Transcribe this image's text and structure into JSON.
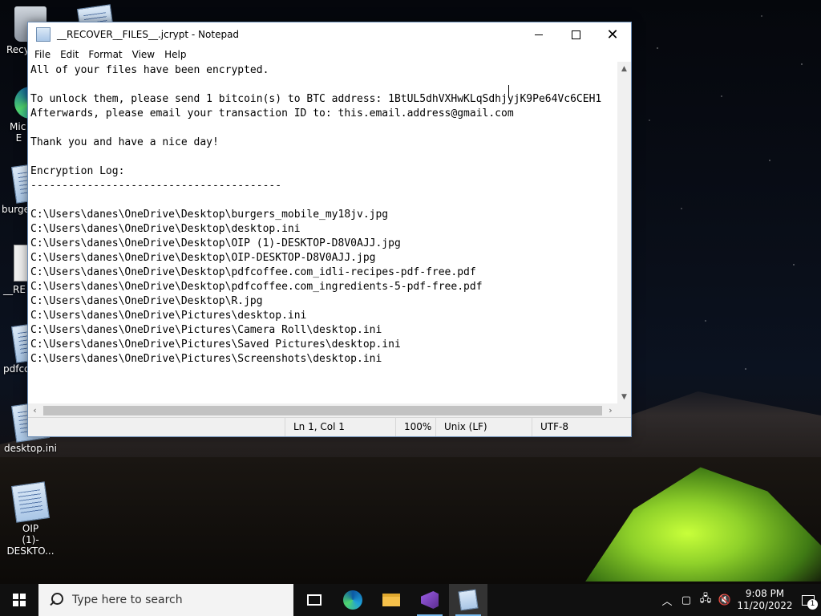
{
  "window": {
    "title": "__RECOVER__FILES__.jcrypt - Notepad",
    "minimize": "",
    "maximize": "",
    "close": "✕"
  },
  "menu": [
    "File",
    "Edit",
    "Format",
    "View",
    "Help"
  ],
  "editor": {
    "lines": [
      "All of your files have been encrypted.",
      "",
      "To unlock them, please send 1 bitcoin(s) to BTC address: 1BtUL5dhVXHwKLqSdhjyjK9Pe64Vc6CEH1",
      "Afterwards, please email your transaction ID to: this.email.address@gmail.com",
      "",
      "Thank you and have a nice day!",
      "",
      "Encryption Log:",
      "----------------------------------------",
      "",
      "C:\\Users\\danes\\OneDrive\\Desktop\\burgers_mobile_my18jv.jpg",
      "C:\\Users\\danes\\OneDrive\\Desktop\\desktop.ini",
      "C:\\Users\\danes\\OneDrive\\Desktop\\OIP (1)-DESKTOP-D8V0AJJ.jpg",
      "C:\\Users\\danes\\OneDrive\\Desktop\\OIP-DESKTOP-D8V0AJJ.jpg",
      "C:\\Users\\danes\\OneDrive\\Desktop\\pdfcoffee.com_idli-recipes-pdf-free.pdf",
      "C:\\Users\\danes\\OneDrive\\Desktop\\pdfcoffee.com_ingredients-5-pdf-free.pdf",
      "C:\\Users\\danes\\OneDrive\\Desktop\\R.jpg",
      "C:\\Users\\danes\\OneDrive\\Pictures\\desktop.ini",
      "C:\\Users\\danes\\OneDrive\\Pictures\\Camera Roll\\desktop.ini",
      "C:\\Users\\danes\\OneDrive\\Pictures\\Saved Pictures\\desktop.ini",
      "C:\\Users\\danes\\OneDrive\\Pictures\\Screenshots\\desktop.ini"
    ]
  },
  "status": {
    "position": "Ln 1, Col 1",
    "zoom": "100%",
    "line_ending": "Unix (LF)",
    "encoding": "UTF-8"
  },
  "desktop_icons": [
    {
      "label": "Recy",
      "icon": "recycle-bin-icon"
    },
    {
      "label": "Mic\nE",
      "icon": "edge-icon"
    },
    {
      "label": "burge",
      "icon": "image-file-icon"
    },
    {
      "label": "__RE",
      "icon": "document-icon"
    },
    {
      "label": "pdfco",
      "icon": "pdf-file-icon"
    },
    {
      "label": "desktop.ini",
      "icon": "notepad-file-icon"
    },
    {
      "label": "OIP\n(1)-DESKTO...",
      "icon": "notepad-file-icon"
    }
  ],
  "taskbar": {
    "search_placeholder": "Type here to search",
    "time": "9:08 PM",
    "date": "11/20/2022",
    "notification_count": "1",
    "accent": "#76b9ed"
  }
}
